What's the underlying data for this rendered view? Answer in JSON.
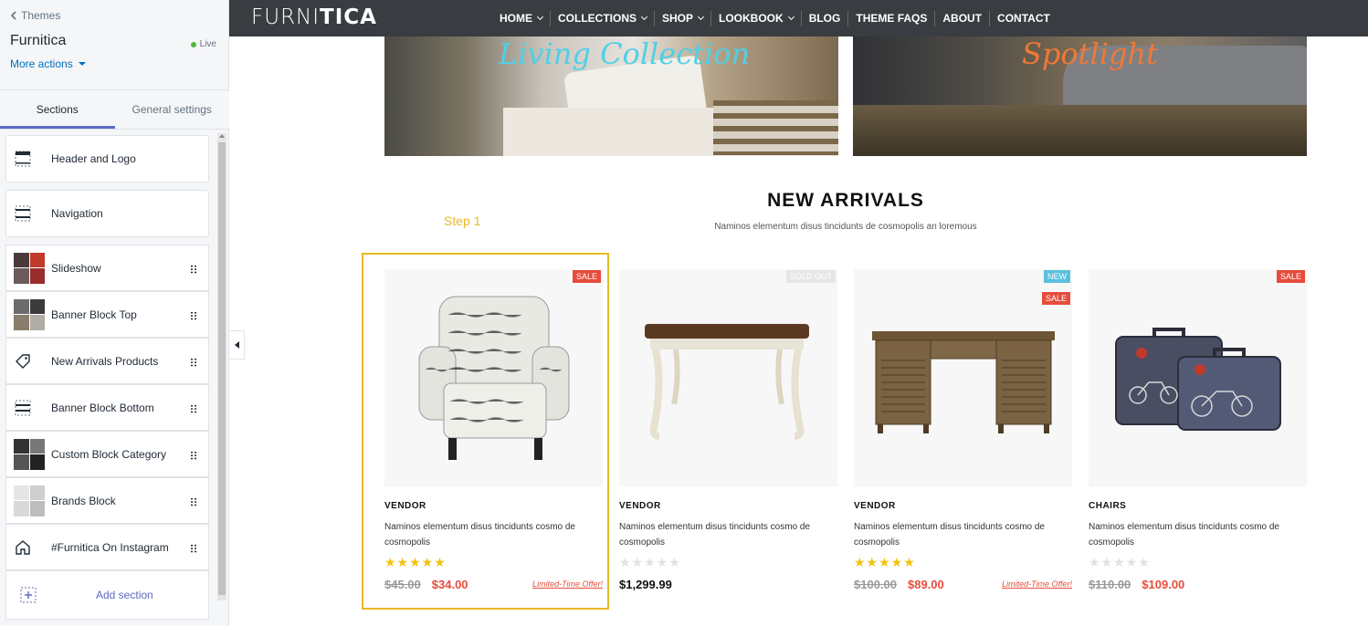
{
  "sidebar": {
    "back_label": "Themes",
    "store_name": "Furnitica",
    "status": "Live",
    "more_actions": "More actions",
    "tabs": [
      {
        "label": "Sections",
        "active": true
      },
      {
        "label": "General settings",
        "active": false
      }
    ],
    "sections": [
      {
        "label": "Header and Logo",
        "icon": "header-layout-icon"
      },
      {
        "label": "Navigation",
        "icon": "navigation-layout-icon"
      },
      {
        "label": "Slideshow",
        "icon": "slideshow-thumbnail"
      },
      {
        "label": "Banner Block Top",
        "icon": "banner-thumbnail"
      },
      {
        "label": "New Arrivals Products",
        "icon": "tag-icon"
      },
      {
        "label": "Banner Block Bottom",
        "icon": "banner-layout-icon"
      },
      {
        "label": "Custom Block Category",
        "icon": "category-thumbnail"
      },
      {
        "label": "Brands Block",
        "icon": "brands-thumbnail"
      },
      {
        "label": "#Furnitica On Instagram",
        "icon": "home-icon"
      }
    ],
    "add_section": "Add section"
  },
  "header": {
    "logo_light": "FURNI",
    "logo_bold": "TICA",
    "menu": [
      {
        "label": "HOME",
        "dropdown": true
      },
      {
        "label": "COLLECTIONS",
        "dropdown": true
      },
      {
        "label": "SHOP",
        "dropdown": true
      },
      {
        "label": "LOOKBOOK",
        "dropdown": true
      },
      {
        "label": "BLOG",
        "dropdown": false
      },
      {
        "label": "THEME FAQS",
        "dropdown": false
      },
      {
        "label": "ABOUT",
        "dropdown": false
      },
      {
        "label": "CONTACT",
        "dropdown": false
      }
    ]
  },
  "banners": {
    "left_script": "Living Collection",
    "right_script": "Spotlight"
  },
  "new_arrivals": {
    "title": "NEW ARRIVALS",
    "subtitle": "Naminos elementum disus tincidunts de cosmopolis an loremous",
    "step_label": "Step 1",
    "products": [
      {
        "vendor": "VENDOR",
        "title": "Naminos elementum disus tincidunts cosmo de cosmopolis",
        "badges": [
          "SALE"
        ],
        "rating": 5,
        "old_price": "$45.00",
        "price": "$34.00",
        "offer": "Limited-Time Offer!"
      },
      {
        "vendor": "VENDOR",
        "title": "Naminos elementum disus tincidunts cosmo de cosmopolis",
        "badges": [
          "SOLD OUT"
        ],
        "rating": 0,
        "old_price": "",
        "price": "$1,299.99",
        "offer": ""
      },
      {
        "vendor": "VENDOR",
        "title": "Naminos elementum disus tincidunts cosmo de cosmopolis",
        "badges": [
          "NEW",
          "SALE"
        ],
        "rating": 5,
        "old_price": "$100.00",
        "price": "$89.00",
        "offer": "Limited-Time Offer!"
      },
      {
        "vendor": "CHAIRS",
        "title": "Naminos elementum disus tincidunts cosmo de cosmopolis",
        "badges": [
          "SALE"
        ],
        "rating": 0,
        "old_price": "$110.00",
        "price": "$109.00",
        "offer": ""
      }
    ]
  },
  "colors": {
    "accent": "#5c6ac4",
    "sale": "#e74c3c",
    "highlight": "#e8b923",
    "nav_bg": "#393d42"
  }
}
